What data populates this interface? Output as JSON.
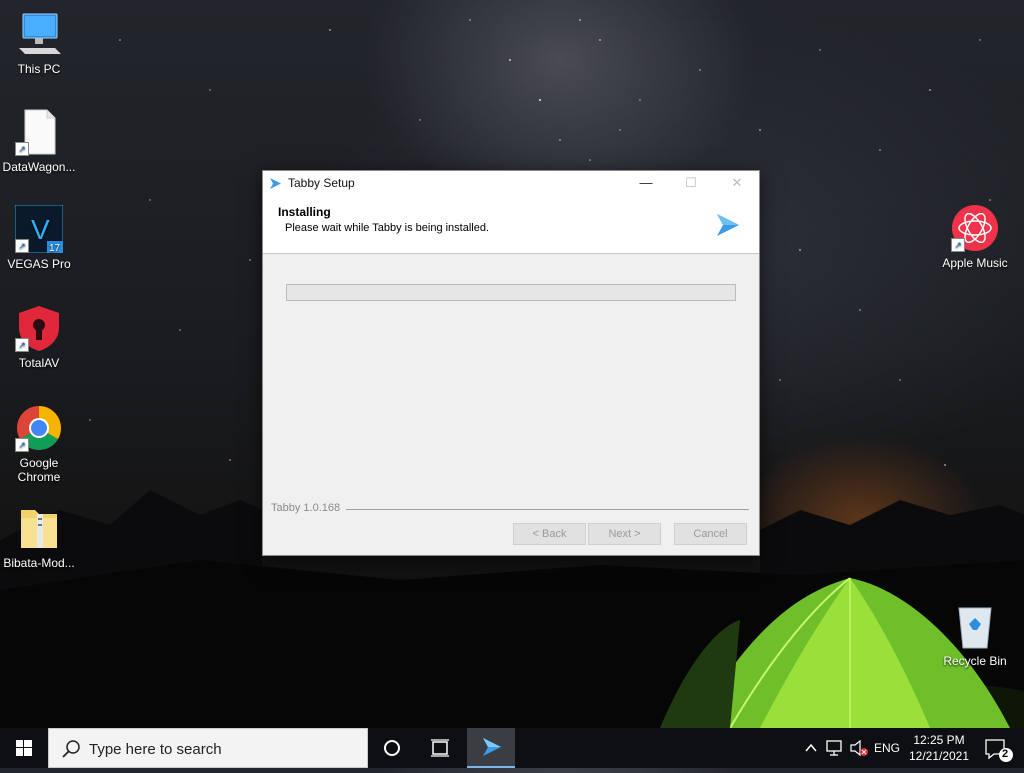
{
  "desktop": {
    "icons": [
      {
        "label": "This PC",
        "icon": "computer-icon"
      },
      {
        "label": "DataWagon...",
        "icon": "document-icon"
      },
      {
        "label": "VEGAS Pro",
        "icon": "vegas-pro-icon",
        "badge": "17",
        "letter": "V"
      },
      {
        "label": "TotalAV",
        "icon": "totalav-shield-icon"
      },
      {
        "label": "Google Chrome",
        "icon": "chrome-icon"
      },
      {
        "label": "Bibata-Mod...",
        "icon": "zip-folder-icon"
      },
      {
        "label": "Apple Music",
        "icon": "apple-music-icon"
      },
      {
        "label": "Recycle Bin",
        "icon": "recycle-bin-icon"
      }
    ]
  },
  "installer": {
    "window_title": "Tabby Setup",
    "controls": {
      "minimize": "—",
      "maximize": "☐",
      "close": "✕"
    },
    "header_title": "Installing",
    "header_subtitle": "Please wait while Tabby is being installed.",
    "progress_percent": 0,
    "branding": "Tabby 1.0.168",
    "buttons": {
      "back": "< Back",
      "next": "Next >",
      "cancel": "Cancel"
    }
  },
  "taskbar": {
    "search_placeholder": "Type here to search",
    "language": "ENG",
    "time": "12:25 PM",
    "date": "12/21/2021",
    "notification_count": "2"
  },
  "colors": {
    "accent_blue": "#3d9be9",
    "progress_green": "#06b025",
    "taskbar": "#0e0f12"
  }
}
